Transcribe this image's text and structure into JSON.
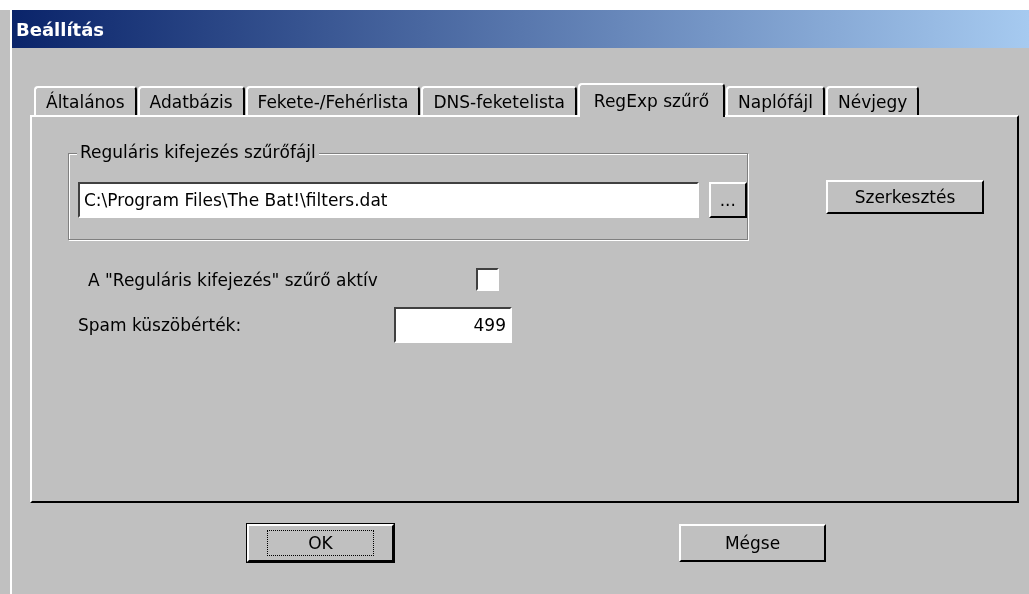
{
  "window": {
    "title": "Beállítás"
  },
  "tabs": [
    {
      "label": "Általános",
      "selected": false
    },
    {
      "label": "Adatbázis",
      "selected": false
    },
    {
      "label": "Fekete-/Fehérlista",
      "selected": false
    },
    {
      "label": "DNS-feketelista",
      "selected": false
    },
    {
      "label": "RegExp szűrő",
      "selected": true
    },
    {
      "label": "Naplófájl",
      "selected": false
    },
    {
      "label": "Névjegy",
      "selected": false
    }
  ],
  "filter_file": {
    "legend": "Reguláris kifejezés szűrőfájl",
    "value": "C:\\Program Files\\The Bat!\\filters.dat",
    "browse_button": "...",
    "edit_button": "Szerkesztés"
  },
  "active_checkbox": {
    "label": "A \"Reguláris kifejezés\" szűrő aktív",
    "checked": false
  },
  "threshold": {
    "label": "Spam küszöbérték:",
    "value": "499"
  },
  "buttons": [
    {
      "label": "OK",
      "default": true
    },
    {
      "label": "Mégse",
      "default": false
    }
  ]
}
